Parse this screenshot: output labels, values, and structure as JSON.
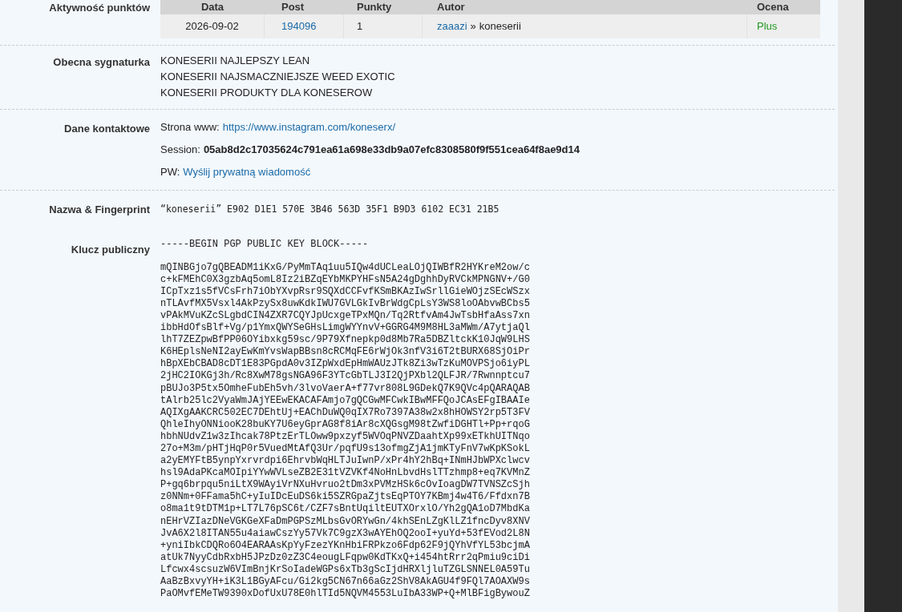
{
  "points_activity": {
    "label": "Aktywność punktów",
    "columns": [
      "Data",
      "Post",
      "Punkty",
      "Autor",
      "Ocena"
    ],
    "rows": [
      {
        "date": "2026-09-02",
        "post": "194096",
        "points": "1",
        "author_from": "zaaazi",
        "author_separator": "»",
        "author_to": "koneserii",
        "rating": "Plus"
      }
    ]
  },
  "signature": {
    "label": "Obecna sygnaturka",
    "lines": [
      "KONESERII NAJLEPSZY LEAN",
      "KONESERII NAJSMACZNIEJSZE WEED EXOTIC",
      "KONESERII PRODUKTY DLA KONESEROW"
    ]
  },
  "contact": {
    "label": "Dane kontaktowe",
    "items": [
      {
        "kind": "link",
        "label": "Strona www:",
        "value": "https://www.instagram.com/koneserx/"
      },
      {
        "kind": "bold",
        "label": "Session:",
        "value": "05ab8d2c17035624c791ea61a698e33db9a07efc8308580f9f551cea64f8ae9d14"
      },
      {
        "kind": "link",
        "label": "PW:",
        "value": "Wyślij prywatną wiadomość"
      }
    ]
  },
  "fingerprint": {
    "label": "Nazwa & Fingerprint",
    "name": "“koneserii”",
    "value": "E902 D1E1 570E 3B46 563D 35F1 B9D3 6102 EC31 21B5"
  },
  "public_key": {
    "label": "Klucz publiczny",
    "header": "-----BEGIN PGP PUBLIC KEY BLOCK-----",
    "lines": [
      "mQINBGjo7gQBEADM1iKxG/PyMmTAq1uu5IQw4dUCLeaLOjQIWBfR2HYKreM2ow/c",
      "c+kFMEhC0X3gzbAq5omL8Iz2iBZqEYbMKPYHFsN5A24gDghhDyRVCkMPNGNV+/G0",
      "ICpTxz1s5fVCsFrh7iObYXvpRsr9SQXdCCFvfKSmBKAzIwSrllGieWOjzSEcWSzx",
      "nTLAvfMX5Vsxl4AkPzySx8uwKdkIWU7GVLGkIvBrWdgCpLsY3WS8loOAbvwBCbs5",
      "vPAkMVuKZcSLgbdCIN4ZXR7CQYJpUcxgeTPxMQn/Tq2RtfvAm4JwTsbHfaAss7xn",
      "ibbHdOfsBlf+Vg/p1YmxQWYSeGHsLimgWYYnvV+GGRG4M9M8HL3aMWm/A7ytjaQl",
      "lhT7ZEZpwBfPP06OYibxkg59sc/9P79Xfnepkp0d8Mb7Ra5DBZltckK10JqW9LHS",
      "K6HEplsNeNI2ayEwKmYvsWapBBsn8cRCMqFE6rWjOk3nfV3i6T2tBURX68SjOiPr",
      "hBpXEbCBAD8cDT1E83PGpdA0v3IZpWxdEpHmWAUzJTk8Zi3wTzKuMOVPSjo6iyPL",
      "2jHC2IOKGj3h/Rc8XwM78gsNGA96F3YTcGbTLJ3I2QjPXbl2QLFJR/7Rwnnptcu7",
      "pBUJo3P5tx5OmheFubEh5vh/3lvoVaerA+f77vr808L9GDekQ7K9QVc4pQARAQAB",
      "tAlrb25lc2VyaWmJAjYEEwEKACAFAmjo7gQCGwMFCwkIBwMFFQoJCAsEFgIBAAIe",
      "AQIXgAAKCRC502EC7DEhtUj+EAChDuWQ0qIX7Ro7397A38w2x8hHOWSY2rp5T3FV",
      "QhleIhyONNiooK28buKY7U6eyGprAG8f8iAr8cXQGsgM98tZwfiDGHTl+Pp+rqoG",
      "hbhNUdvZ1w3zIhcak78PtzErTLOww9pxzyf5WVOqPNVZDaahtXp99xETkhUITNqo",
      "27o+M3m/pHTjHqP0r5VuedMtAfQ3Ur/pqfU9s13ofmgZjA1jmKTyFnV7wKpKSokL",
      "a2yEMYFtB5ynpYxrvrdpi6EhrvbWqHLTJuIwnP/xPr4hY2hBq+INmHJbWPXclwcv",
      "hsl9AdaPKcaMOIpiYYwWVLseZB2E31tVZVKf4NoHnLbvdHslTTzhmp8+eq7KVMnZ",
      "P+gq6brpqu5niLtX9WAyiVrNXuHvruo2tDm3xPVMzHSk6cOvIoagDW7TVNSZcSjh",
      "z0NNm+0FFama5hC+yIuIDcEuDS6ki5SZRGpaZjtsEqPTOY7KBmj4w4T6/Ffdxn7B",
      "o8ma1t9tDTM1p+LT7L76pSC6t/CZF7sBntUqiltEUTXOrxlO/Yh2gQA1oD7MbdKa",
      "nEHrVZIazDNeVGKGeXFaDmPGPSzMLbsGvORYwGn/4khSEnLZgKlLZ1fncDyv8XNV",
      "JvA6X2l8ITAN55u4aiawCszYy57Vk7C9gzX3wAYEhOQ2ooI+yuYd+53fEVod2L8N",
      "+yniIbkCDQRo6O4EARAAsKpYyFzezYKnHbiFRPkzo6Fdp62F9jQYhVfYL53bcjmA",
      "atUk7NyyCdbRxbH5JPzDz0zZ3C4eougLFqpw0KdTKxQ+i454htRrr2qPmiu9ciDi",
      "Lfcwx4scsuzW6VImBnjKrSoIadeWGPs6xTb3gScIjdHRXljluTZGLSNNEL0A59Tu",
      "AaBzBxvyYH+iK3L1BGyAFcu/Gi2kg5CN67n66aGz2ShV8AkAGU4f9FQl7AOAXW9s",
      "PaOMvfEMeTW9390xDofUxU78E0hlTId5NQVM4553LuIbA33WP+Q+MlBFigBywouZ"
    ]
  }
}
